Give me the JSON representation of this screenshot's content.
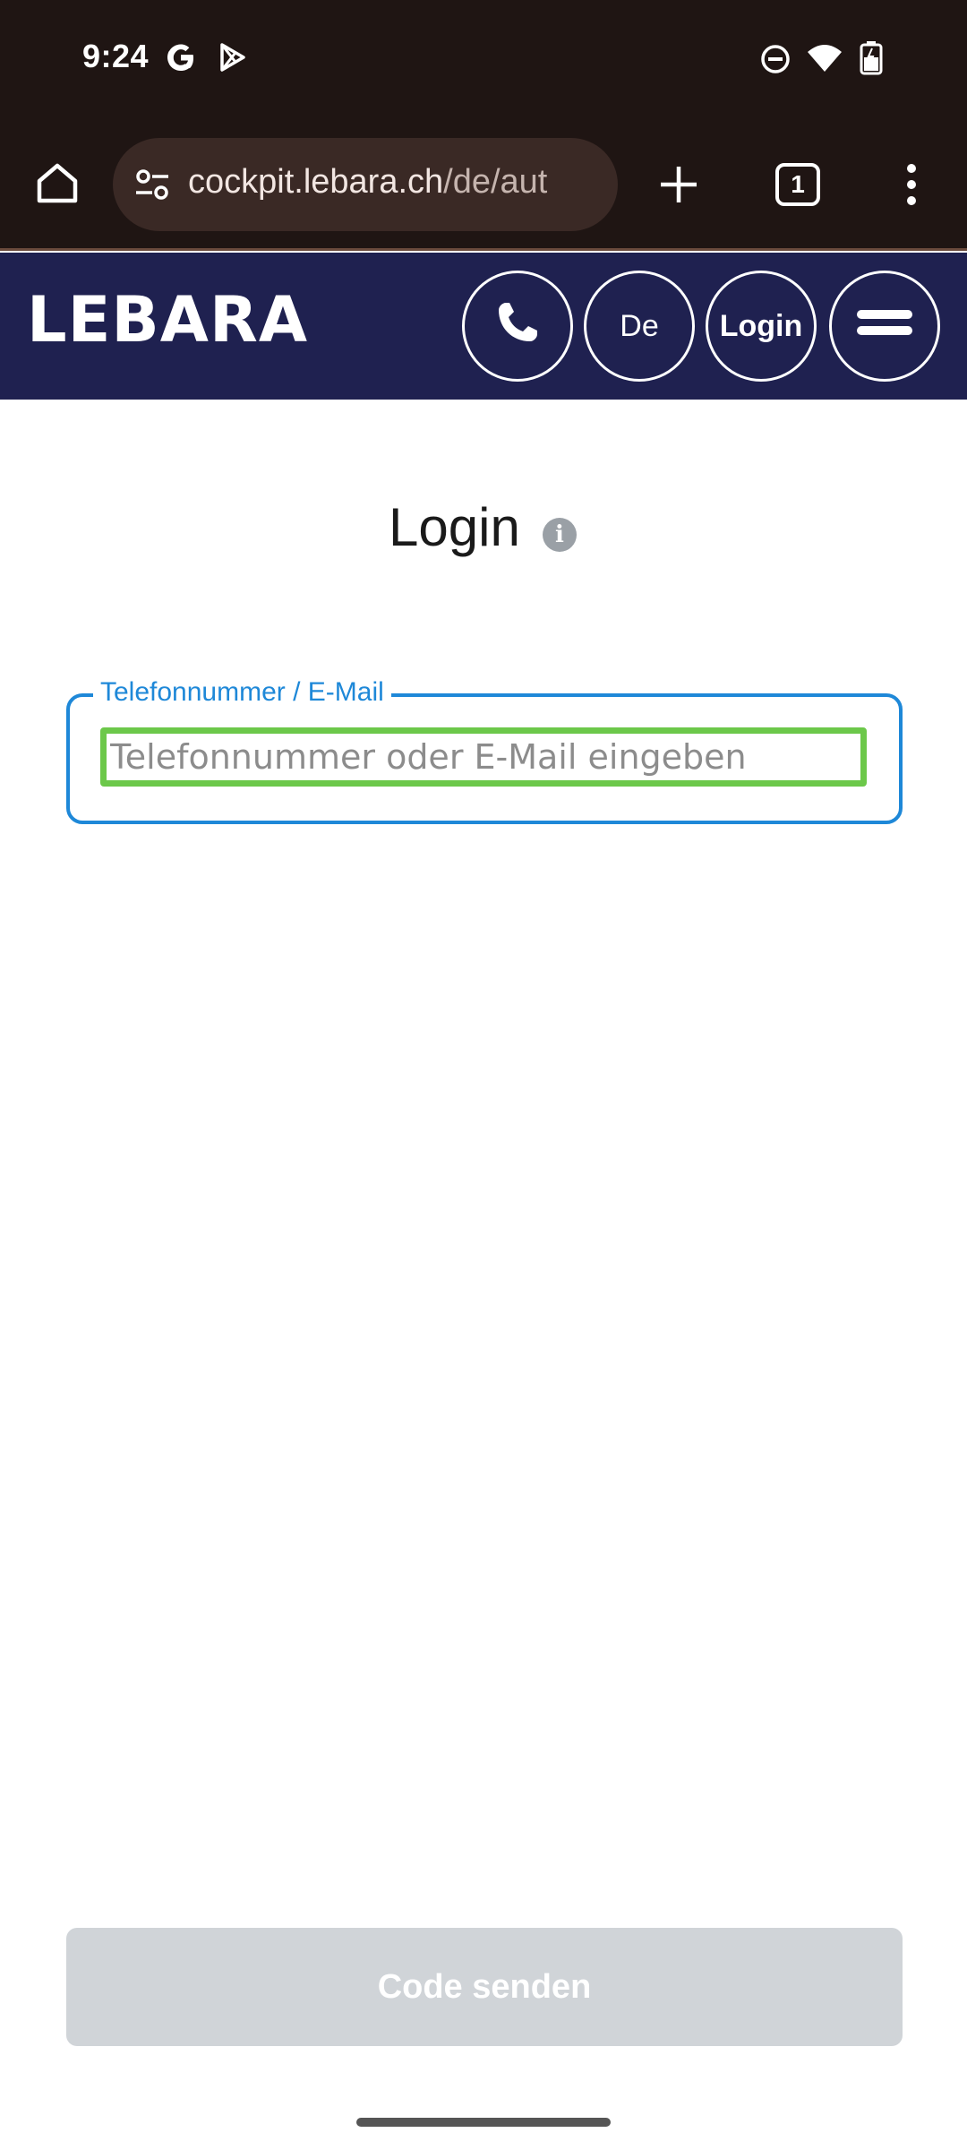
{
  "status_bar": {
    "time": "9:24",
    "icons": [
      "google-icon",
      "play-store-icon",
      "do-not-disturb-icon",
      "wifi-icon",
      "battery-icon"
    ]
  },
  "browser": {
    "url_main": "cockpit.lebara.ch",
    "url_path": "/de/aut",
    "tab_count": "1"
  },
  "header": {
    "logo": "LEBARA",
    "language_label": "De",
    "login_label": "Login",
    "colors": {
      "background": "#1f2150"
    }
  },
  "main": {
    "title": "Login",
    "info_glyph": "i",
    "field": {
      "label": "Telefonnummer / E-Mail",
      "placeholder": "Telefonnummer oder E-Mail eingeben",
      "value": ""
    },
    "submit_label": "Code senden",
    "colors": {
      "accent": "#1e88d8",
      "highlight": "#6cc84a",
      "disabled": "#d0d4d8"
    }
  }
}
